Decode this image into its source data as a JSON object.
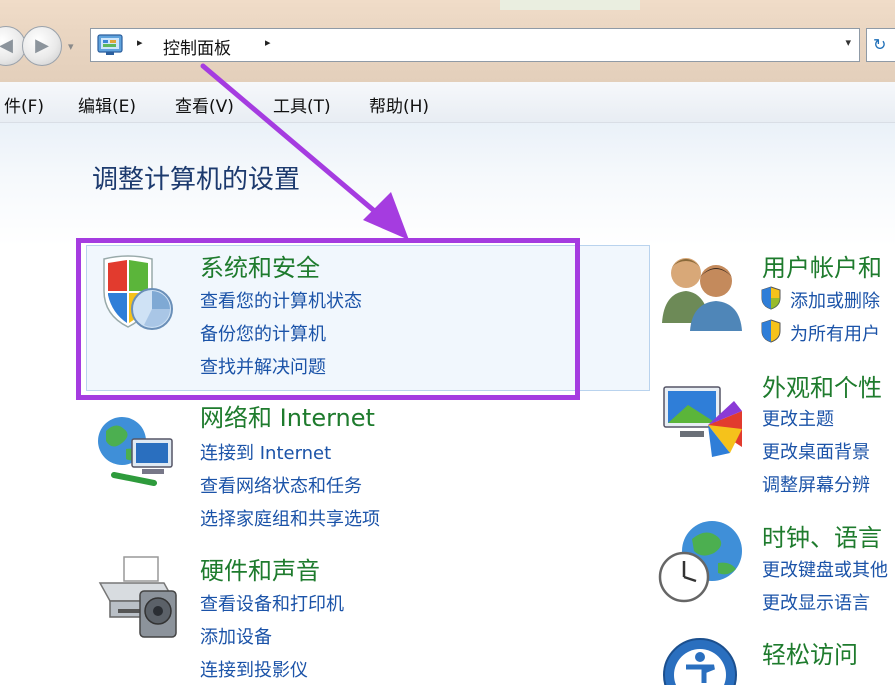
{
  "address_bar": {
    "breadcrumb": "控制面板",
    "arrow": "▸",
    "dropdown": "▾",
    "refresh": "↻"
  },
  "menu": {
    "items": [
      "件(F)",
      "编辑(E)",
      "查看(V)",
      "工具(T)",
      "帮助(H)"
    ]
  },
  "page_title": "调整计算机的设置",
  "categories": [
    {
      "title": "系统和安全",
      "icon": "security-shield-icon",
      "links": [
        "查看您的计算机状态",
        "备份您的计算机",
        "查找并解决问题"
      ]
    },
    {
      "title": "网络和 Internet",
      "icon": "network-globe-icon",
      "links": [
        "连接到 Internet",
        "查看网络状态和任务",
        "选择家庭组和共享选项"
      ]
    },
    {
      "title": "硬件和声音",
      "icon": "printer-icon",
      "links": [
        "查看设备和打印机",
        "添加设备",
        "连接到投影仪"
      ]
    },
    {
      "title": "用户帐户和",
      "icon": "users-icon",
      "links": [
        "添加或删除",
        "为所有用户"
      ]
    },
    {
      "title": "外观和个性",
      "icon": "display-palette-icon",
      "links": [
        "更改主题",
        "更改桌面背景",
        "调整屏幕分辨"
      ]
    },
    {
      "title": "时钟、语言",
      "icon": "clock-globe-icon",
      "links": [
        "更改键盘或其他",
        "更改显示语言"
      ]
    },
    {
      "title": "轻松访问",
      "icon": "ease-of-access-icon",
      "links": []
    }
  ],
  "colors": {
    "annotation": "#a53ce0",
    "category_title": "#1e7b2d",
    "link": "#1b53a8",
    "page_title": "#1c3a6e"
  }
}
